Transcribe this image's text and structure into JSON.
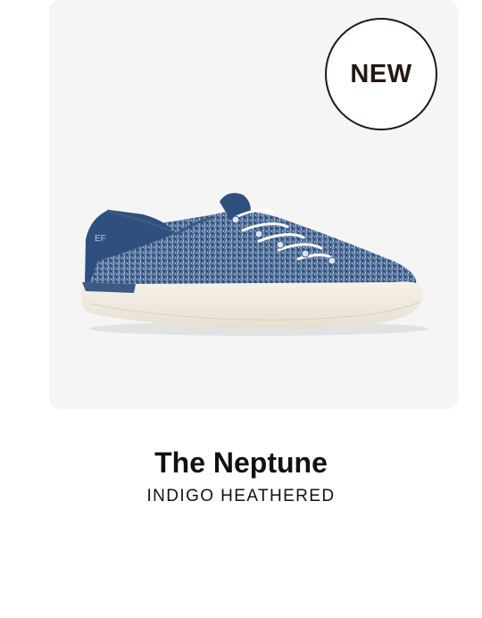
{
  "product": {
    "badge": "NEW",
    "name": "The Neptune",
    "colorway": "INDIGO HEATHERED",
    "image_icon": "sneaker-image"
  },
  "colors": {
    "panel_background": "#f5f5f5",
    "badge_ink": "#231815",
    "upper_indigo": "#3c5a82",
    "heel_navy": "#2f4f7f",
    "sole_cream": "#f1ece1",
    "laces": "#ffffff"
  }
}
